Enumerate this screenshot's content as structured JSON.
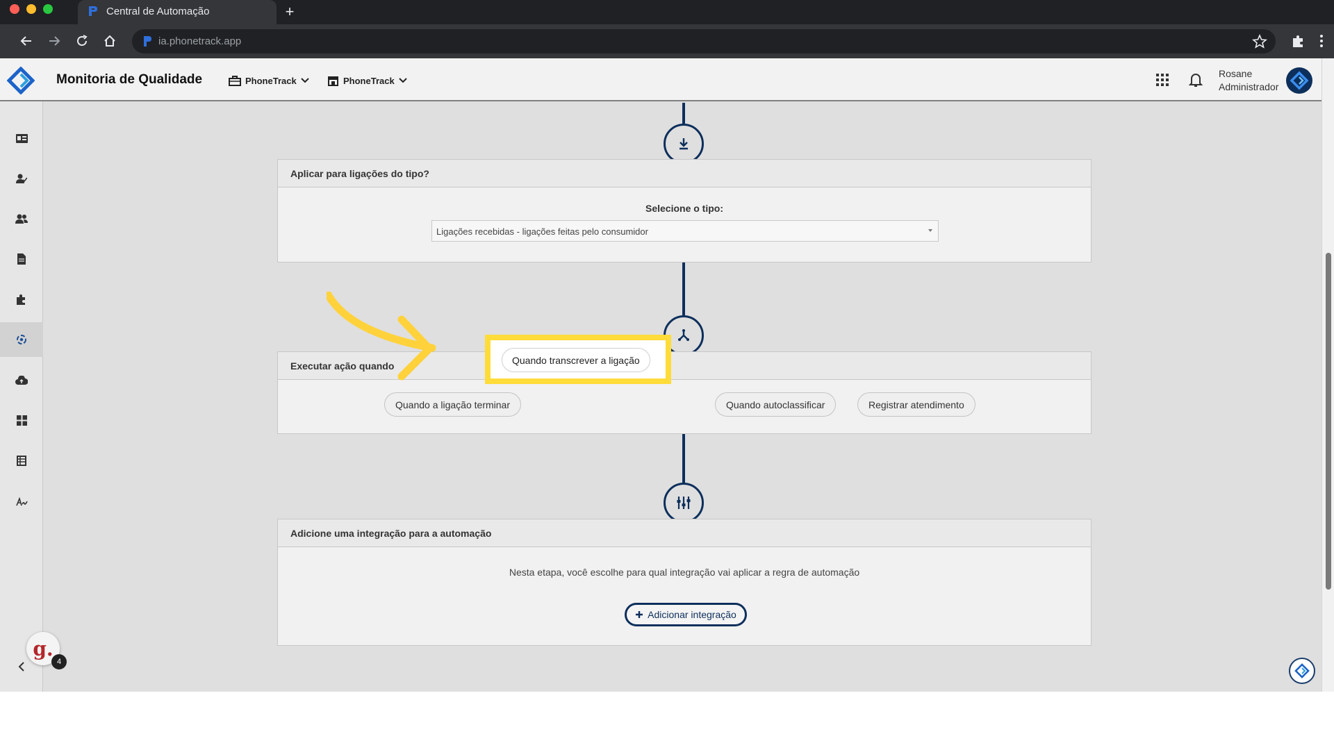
{
  "browser": {
    "tab_title": "Central de Automação",
    "new_tab": "+",
    "url": "ia.phonetrack.app"
  },
  "header": {
    "title": "Monitoria de Qualidade",
    "company_1": "PhoneTrack",
    "company_2": "PhoneTrack",
    "user_name": "Rosane",
    "user_role": "Administrador"
  },
  "sidebar": {
    "notification_badge": "g.",
    "notification_count": "4"
  },
  "steps": {
    "type_card": {
      "title": "Aplicar para ligações do tipo?",
      "select_label": "Selecione o tipo:",
      "select_value": "Ligações recebidas - ligações feitas pelo consumidor"
    },
    "action_card": {
      "title": "Executar ação quando",
      "options": [
        "Quando a ligação terminar",
        "Quando transcrever a ligação",
        "Quando autoclassificar",
        "Registrar atendimento"
      ]
    },
    "integration_card": {
      "title": "Adicione uma integração para a automação",
      "description": "Nesta etapa, você escolhe para qual integração vai aplicar a regra de automação",
      "add_button": "Adicionar integração"
    }
  },
  "colors": {
    "brand_navy": "#0d2f5c",
    "highlight_yellow": "#ffdc3a"
  }
}
